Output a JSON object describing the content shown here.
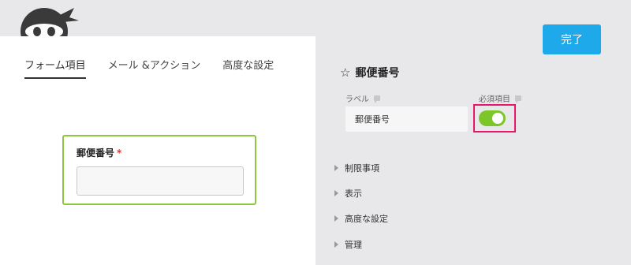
{
  "tabs": [
    "フォーム項目",
    "メール &アクション",
    "高度な設定"
  ],
  "field": {
    "label": "郵便番号",
    "required_mark": "*"
  },
  "toolbar": {
    "done_label": "完了"
  },
  "settings": {
    "title": "郵便番号",
    "label_caption": "ラベル",
    "label_value": "郵便番号",
    "required_caption": "必須項目",
    "required_on": true,
    "sections": [
      "制限事項",
      "表示",
      "高度な設定",
      "管理"
    ]
  },
  "colors": {
    "accent_blue": "#1ea9ea",
    "field_border": "#8dc63f",
    "toggle_on": "#7dc62a",
    "highlight": "#e8176a"
  }
}
